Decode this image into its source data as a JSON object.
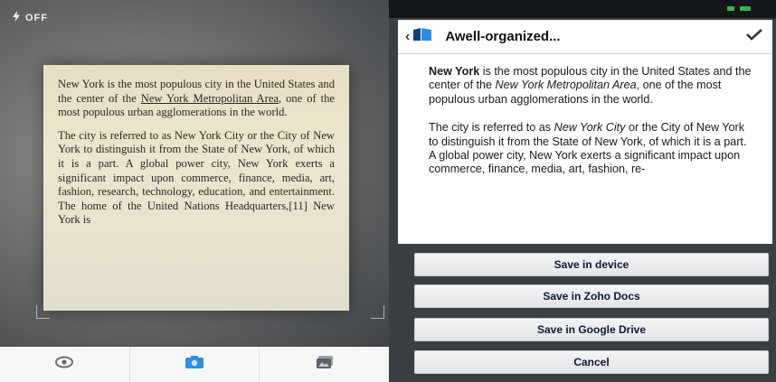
{
  "camera": {
    "flash_label": "OFF",
    "flash_icon": "flash-icon",
    "page_text": {
      "p1_pre": "New York is the most populous city in the United States and the center of the ",
      "p1_link": "New York Metropolitan Area",
      "p1_post": ", one of the most populous urban agglomerations in the world.",
      "p2": "The city is referred to as New York City or the City of New York to distinguish it from the State of New York, of which it is a part. A global power city, New York exerts a significant impact upon commerce, finance, media, art, fashion, research, technology, education, and entertainment. The home of the United Nations Headquarters,[11] New York is"
    },
    "toolbar": {
      "left_icon": "eye-icon",
      "center_icon": "camera-icon",
      "right_icon": "gallery-icon"
    }
  },
  "preview": {
    "back_label": "‹",
    "title": "Awell-organized...",
    "body": {
      "p1_bold": "New York",
      "p1_a": " is the most populous city in the United States and the center of the ",
      "p1_italic": "New York Metropolitan Area",
      "p1_b": ", one of the most populous urban agglomerations in the world.",
      "p2_a": "The city is referred to as ",
      "p2_italic": "New York City",
      "p2_b": " or the City of New York to distinguish it from the State of New York, of which it is a part. A global power city, New York exerts a significant impact upon commerce, finance, media, art, fashion, re-"
    }
  },
  "actions": {
    "save_device": "Save in device",
    "save_zoho": "Save in Zoho Docs",
    "save_drive": "Save in Google Drive",
    "cancel": "Cancel"
  },
  "colors": {
    "accent": "#1c3f73",
    "panel_bg": "#3a3f44",
    "page_paper": "#e7dfc3"
  }
}
